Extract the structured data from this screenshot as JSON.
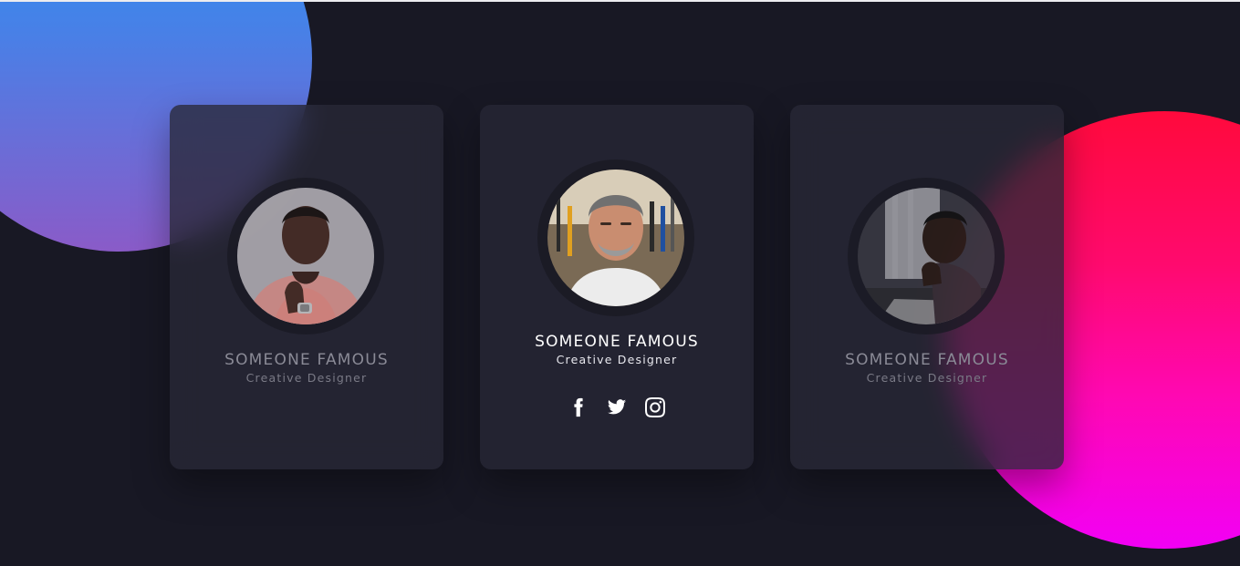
{
  "colors": {
    "background": "#181824",
    "card": "#232331",
    "blob_blue_top": "#1f97f5",
    "blob_blue_bottom": "#8a5bc8",
    "blob_pink_top": "#ff0a3c",
    "blob_pink_bottom": "#f200f5"
  },
  "cards": [
    {
      "name": "SOMEONE FAMOUS",
      "role": "Creative Designer"
    },
    {
      "name": "SOMEONE FAMOUS",
      "role": "Creative Designer",
      "social": [
        "facebook-icon",
        "twitter-icon",
        "instagram-icon"
      ]
    },
    {
      "name": "SOMEONE FAMOUS",
      "role": "Creative Designer"
    }
  ]
}
